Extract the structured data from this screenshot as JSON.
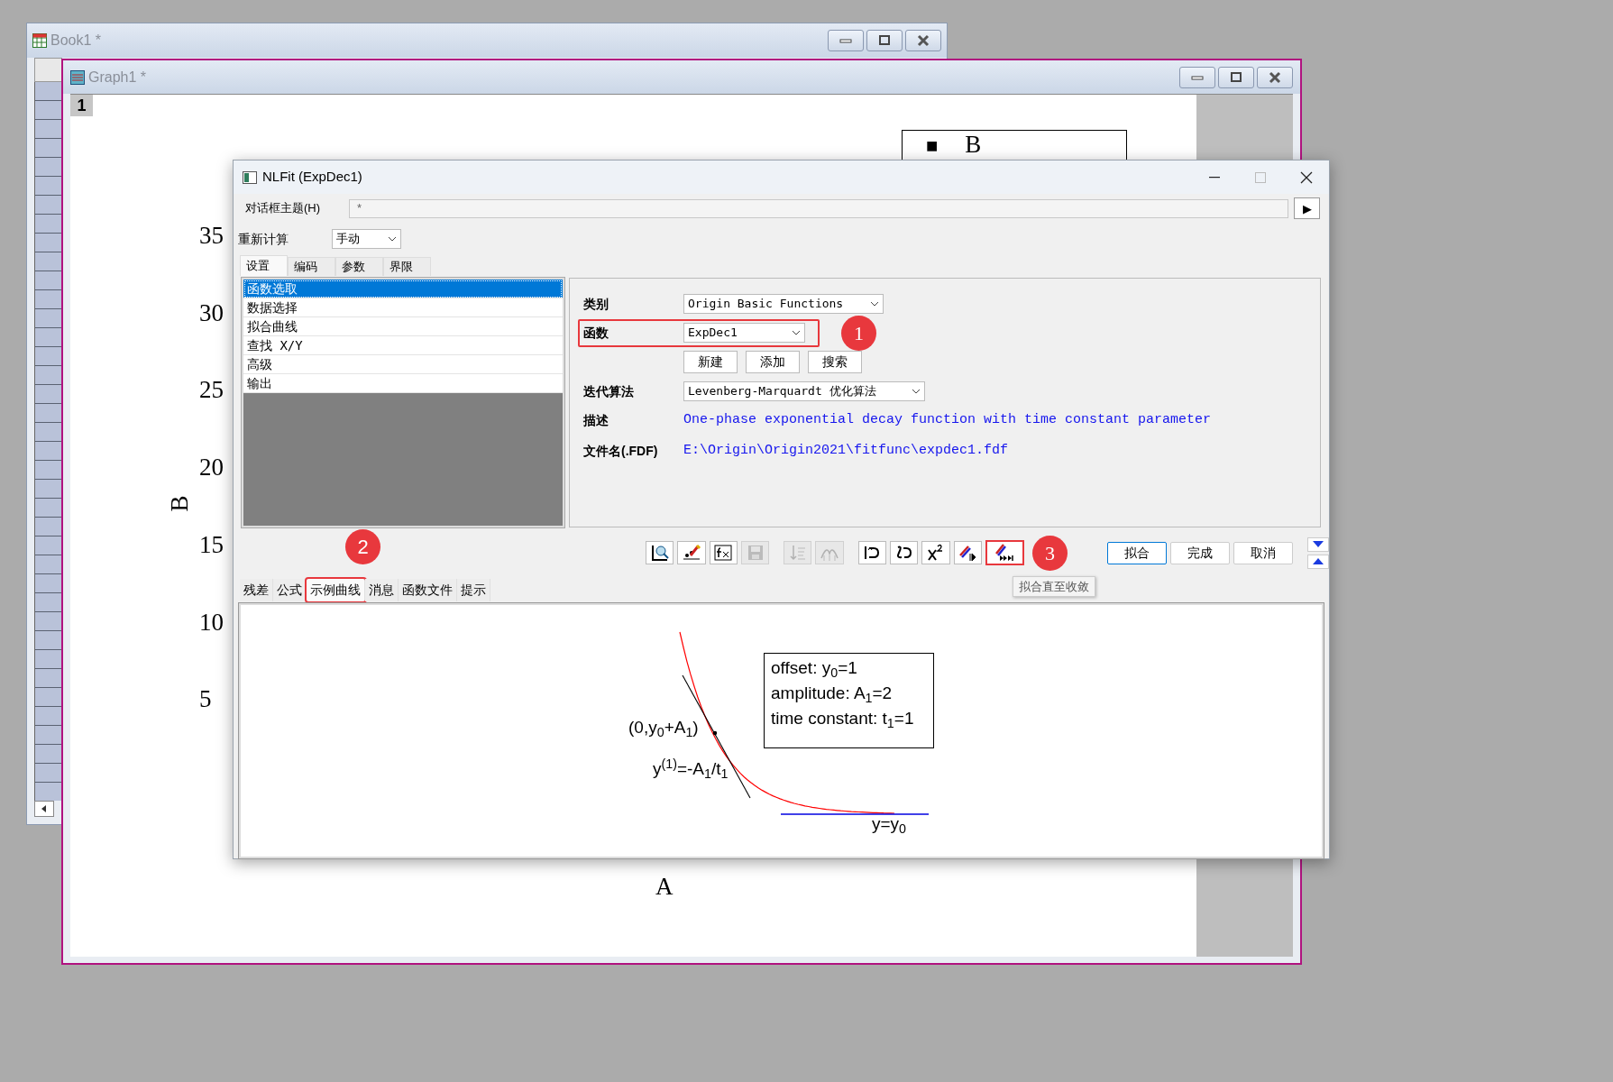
{
  "book": {
    "title": "Book1 *"
  },
  "graph": {
    "title": "Graph1 *",
    "layer": "1",
    "y_tick_labels": [
      "35",
      "30",
      "25",
      "20",
      "15",
      "10",
      "5"
    ],
    "y_axis_title": "B",
    "x_axis_title": "A",
    "legend": {
      "symbol": "■",
      "label": "B"
    }
  },
  "dialog": {
    "title": "NLFit (ExpDec1)",
    "theme": {
      "label": "对话框主题(H)",
      "value": "*",
      "arrow": "▶"
    },
    "recalculate": {
      "label": "重新计算",
      "value": "手动"
    },
    "tabs": [
      {
        "label": "设置",
        "selected": true
      },
      {
        "label": "编码",
        "selected": false
      },
      {
        "label": "参数",
        "selected": false
      },
      {
        "label": "界限",
        "selected": false
      }
    ],
    "nav_items": [
      {
        "label": "函数选取",
        "selected": true
      },
      {
        "label": "数据选择",
        "selected": false
      },
      {
        "label": "拟合曲线",
        "selected": false
      },
      {
        "label": "查找 X/Y",
        "selected": false
      },
      {
        "label": "高级",
        "selected": false
      },
      {
        "label": "输出",
        "selected": false
      }
    ],
    "fields": [
      {
        "kind": "dropdown",
        "label": "类别",
        "value": "Origin Basic Functions",
        "highlighted": false
      },
      {
        "kind": "dropdown",
        "label": "函数",
        "value": "ExpDec1",
        "highlighted": true,
        "badge": "1"
      },
      {
        "kind": "buttons",
        "buttons": [
          "新建",
          "添加",
          "搜索"
        ],
        "highlighted": false
      },
      {
        "kind": "dropdown",
        "label": "迭代算法",
        "value": "Levenberg-Marquardt 优化算法",
        "highlighted": false
      },
      {
        "kind": "text",
        "label": "描述",
        "value": "One-phase exponential decay function with time constant parameter",
        "highlighted": false
      },
      {
        "kind": "text",
        "label": "文件名(.FDF)",
        "value": "E:\\Origin\\Origin2021\\fitfunc\\expdec1.fdf",
        "highlighted": false
      }
    ],
    "toolbar": [
      {
        "kind": "search",
        "disabled": false,
        "highlighted": false
      },
      {
        "kind": "pen",
        "disabled": false,
        "highlighted": false
      },
      {
        "kind": "function",
        "disabled": false,
        "highlighted": false
      },
      {
        "kind": "save",
        "disabled": true,
        "highlighted": false
      },
      {
        "kind": "sort",
        "disabled": true,
        "highlighted": false
      },
      {
        "kind": "peaks",
        "disabled": true,
        "highlighted": false
      },
      {
        "kind": "undo",
        "disabled": false,
        "highlighted": false
      },
      {
        "kind": "undo2",
        "disabled": false,
        "highlighted": false
      },
      {
        "kind": "chisq",
        "disabled": false,
        "highlighted": false
      },
      {
        "kind": "step",
        "disabled": false,
        "highlighted": false
      },
      {
        "kind": "converge",
        "disabled": false,
        "highlighted": true,
        "badge": "3"
      }
    ],
    "tooltip": "拟合直至收敛",
    "actions": [
      {
        "label": "拟合",
        "default": true
      },
      {
        "label": "完成",
        "default": false
      },
      {
        "label": "取消",
        "default": false
      }
    ],
    "bottom_tabs": [
      {
        "label": "残差",
        "selected": false,
        "highlighted": false
      },
      {
        "label": "公式",
        "selected": false,
        "highlighted": false
      },
      {
        "label": "示例曲线",
        "selected": true,
        "highlighted": true,
        "badge": "2"
      },
      {
        "label": "消息",
        "selected": false,
        "highlighted": false
      },
      {
        "label": "函数文件",
        "selected": false,
        "highlighted": false
      },
      {
        "label": "提示",
        "selected": false,
        "highlighted": false
      }
    ],
    "sample": {
      "legend": [
        "offset: y$_{0}$=1",
        "amplitude: A$_{1}$=2",
        "time constant: t$_{1}$=1"
      ],
      "point_label": "(0,y$_{0}$+A$_{1}$)",
      "slope_label": "y$^{(1)}$=-A$_{1}$/t$_{1}$",
      "asymptote_label": "y=y$_{0}$"
    }
  }
}
